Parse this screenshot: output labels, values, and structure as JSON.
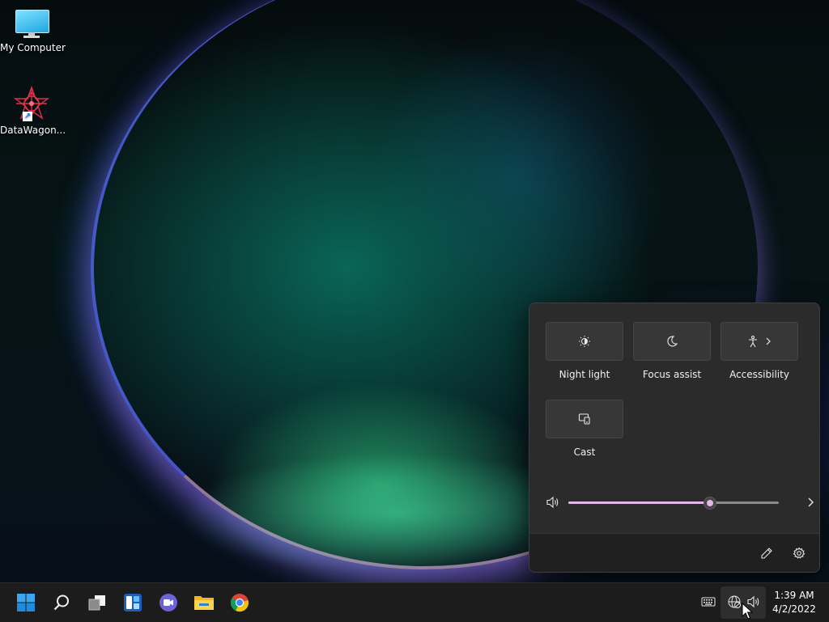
{
  "desktop": {
    "icons": [
      {
        "label": "My Computer",
        "icon": "monitor-icon"
      },
      {
        "label": "DataWagon...",
        "icon": "datawagon-app-icon",
        "shortcut": true
      }
    ]
  },
  "quick_settings": {
    "tiles": [
      {
        "label": "Night light",
        "icon": "night-light-icon"
      },
      {
        "label": "Focus assist",
        "icon": "moon-icon"
      },
      {
        "label": "Accessibility",
        "icon": "accessibility-icon",
        "has_chevron": true
      },
      {
        "label": "Cast",
        "icon": "cast-icon"
      }
    ],
    "volume": {
      "level": 0.67,
      "icon": "speaker-icon"
    },
    "footer": {
      "edit_icon": "pencil-icon",
      "settings_icon": "gear-icon"
    },
    "accent_color": "#e5b6e9"
  },
  "taskbar": {
    "apps": [
      "start-icon",
      "search-icon",
      "task-view-icon",
      "widgets-icon",
      "teams-chat-icon",
      "file-explorer-icon",
      "chrome-icon"
    ],
    "tray": [
      "keyboard-icon",
      "network-icon",
      "volume-icon"
    ],
    "clock": {
      "time": "1:39 AM",
      "date": "4/2/2022"
    }
  }
}
